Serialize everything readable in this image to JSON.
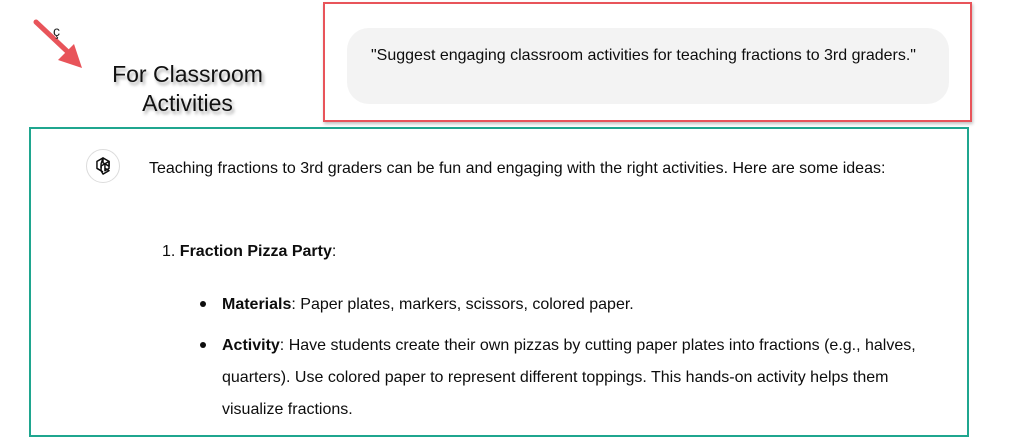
{
  "annotation": {
    "caption": "For Classroom Activities",
    "stray_mark": "ç",
    "arrow_color": "#e8545a",
    "prompt_frame_color": "#e8545a",
    "response_frame_color": "#1fa68f"
  },
  "user_message": {
    "text": "\"Suggest engaging classroom activities for teaching fractions to 3rd graders.\""
  },
  "assistant_message": {
    "avatar_icon": "openai-logo-icon",
    "intro": "Teaching fractions to 3rd graders can be fun and engaging with the right activities. Here are some ideas:",
    "items": [
      {
        "number": "1.",
        "title": "Fraction Pizza Party",
        "suffix": ":",
        "bullets": [
          {
            "label": "Materials",
            "text": ": Paper plates, markers, scissors, colored paper."
          },
          {
            "label": "Activity",
            "text": ": Have students create their own pizzas by cutting paper plates into fractions (e.g., halves, quarters). Use colored paper to represent different toppings. This hands-on activity helps them visualize fractions."
          }
        ]
      }
    ]
  }
}
